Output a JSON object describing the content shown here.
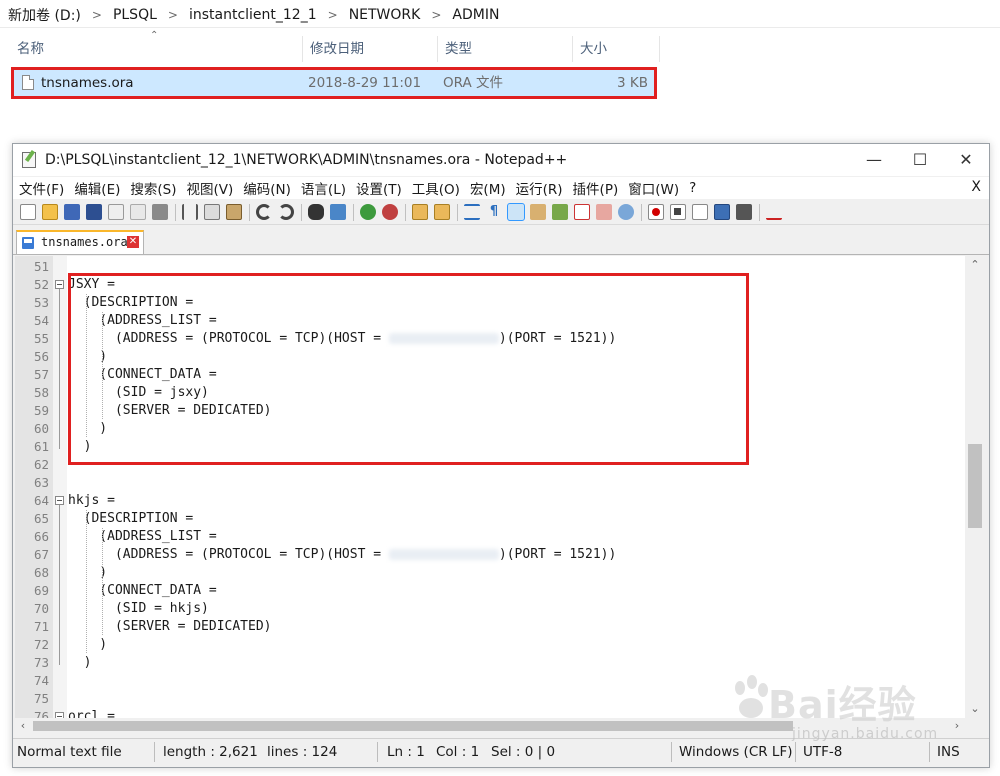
{
  "explorer": {
    "breadcrumb": [
      "新加卷 (D:)",
      "PLSQL",
      "instantclient_12_1",
      "NETWORK",
      "ADMIN"
    ],
    "columns": {
      "name": "名称",
      "modified": "修改日期",
      "type": "类型",
      "size": "大小"
    },
    "file": {
      "name": "tnsnames.ora",
      "modified": "2018-8-29 11:01",
      "type": "ORA 文件",
      "size": "3 KB"
    }
  },
  "notepad": {
    "title": "D:\\PLSQL\\instantclient_12_1\\NETWORK\\ADMIN\\tnsnames.ora - Notepad++",
    "window_buttons": {
      "minimize": "—",
      "maximize": "☐",
      "close": "✕"
    },
    "menu": [
      "文件(F)",
      "编辑(E)",
      "搜索(S)",
      "视图(V)",
      "编码(N)",
      "语言(L)",
      "设置(T)",
      "工具(O)",
      "宏(M)",
      "运行(R)",
      "插件(P)",
      "窗口(W)",
      "?"
    ],
    "menu_close": "X",
    "tab": {
      "label": "tnsnames.ora",
      "close": "✕"
    },
    "lines": [
      {
        "n": "51",
        "text": ""
      },
      {
        "n": "52",
        "text": "JSXY ="
      },
      {
        "n": "53",
        "text": "  (DESCRIPTION ="
      },
      {
        "n": "54",
        "text": "    (ADDRESS_LIST ="
      },
      {
        "n": "55",
        "pre": "      (ADDRESS = (PROTOCOL = TCP)(HOST = ",
        "post": ")(PORT = 1521))"
      },
      {
        "n": "56",
        "text": "    )"
      },
      {
        "n": "57",
        "text": "    (CONNECT_DATA ="
      },
      {
        "n": "58",
        "text": "      (SID = jsxy)"
      },
      {
        "n": "59",
        "text": "      (SERVER = DEDICATED)"
      },
      {
        "n": "60",
        "text": "    )"
      },
      {
        "n": "61",
        "text": "  )"
      },
      {
        "n": "62",
        "text": ""
      },
      {
        "n": "63",
        "text": ""
      },
      {
        "n": "64",
        "text": "hkjs ="
      },
      {
        "n": "65",
        "text": "  (DESCRIPTION ="
      },
      {
        "n": "66",
        "text": "    (ADDRESS_LIST ="
      },
      {
        "n": "67",
        "pre": "      (ADDRESS = (PROTOCOL = TCP)(HOST = ",
        "post": ")(PORT = 1521))"
      },
      {
        "n": "68",
        "text": "    )"
      },
      {
        "n": "69",
        "text": "    (CONNECT_DATA ="
      },
      {
        "n": "70",
        "text": "      (SID = hkjs)"
      },
      {
        "n": "71",
        "text": "      (SERVER = DEDICATED)"
      },
      {
        "n": "72",
        "text": "    )"
      },
      {
        "n": "73",
        "text": "  )"
      },
      {
        "n": "74",
        "text": ""
      },
      {
        "n": "75",
        "text": ""
      },
      {
        "n": "76",
        "text": "orcl ="
      }
    ],
    "status": {
      "type": "Normal text file",
      "length": "length : 2,621",
      "lines": "lines : 124",
      "ln": "Ln : 1",
      "col": "Col : 1",
      "sel": "Sel : 0 | 0",
      "eol": "Windows (CR LF)",
      "encoding": "UTF-8",
      "mode": "INS"
    }
  },
  "watermark": {
    "brand": "Bai经验",
    "url": "jingyan.baidu.com"
  },
  "colors": {
    "highlight": "#e02020",
    "selection": "#cde8ff",
    "tab_accent": "#fab72b"
  }
}
